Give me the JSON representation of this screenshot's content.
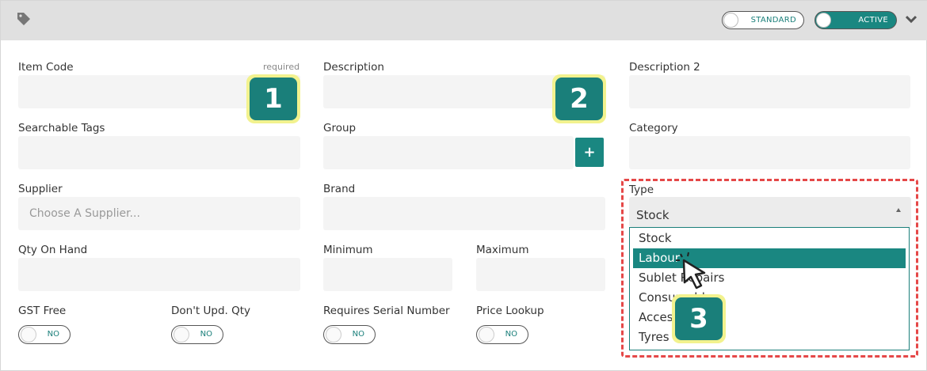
{
  "header": {
    "tag_icon": "tag-icon",
    "toggle_standard": "STANDARD",
    "toggle_active": "ACTIVE",
    "chevron_icon": "chevron-down-icon"
  },
  "fields": {
    "item_code": {
      "label": "Item Code",
      "required": "required",
      "value": ""
    },
    "description": {
      "label": "Description",
      "value": ""
    },
    "description2": {
      "label": "Description 2",
      "value": ""
    },
    "searchable_tags": {
      "label": "Searchable Tags",
      "value": ""
    },
    "group": {
      "label": "Group",
      "value": "",
      "add_label": "+"
    },
    "category": {
      "label": "Category",
      "value": ""
    },
    "supplier": {
      "label": "Supplier",
      "placeholder": "Choose A Supplier..."
    },
    "brand": {
      "label": "Brand",
      "value": ""
    },
    "qty_on_hand": {
      "label": "Qty On Hand",
      "value": ""
    },
    "minimum": {
      "label": "Minimum",
      "value": ""
    },
    "maximum": {
      "label": "Maximum",
      "value": ""
    }
  },
  "switches": {
    "gst_free": {
      "label": "GST Free",
      "state": "NO"
    },
    "dont_upd_qty": {
      "label": "Don't Upd. Qty",
      "state": "NO"
    },
    "requires_serial": {
      "label": "Requires Serial Number",
      "state": "NO"
    },
    "price_lookup": {
      "label": "Price Lookup",
      "state": "NO"
    }
  },
  "type": {
    "label": "Type",
    "selected": "Stock",
    "options": [
      "Stock",
      "Labour",
      "Sublet Repairs",
      "Consumables",
      "Accessories",
      "Tyres"
    ],
    "highlighted": "Labour"
  },
  "badges": [
    "1",
    "2",
    "3"
  ],
  "colors": {
    "accent": "#1a8781",
    "badge_ring": "#f2f28e",
    "highlight_box": "#e54848"
  }
}
